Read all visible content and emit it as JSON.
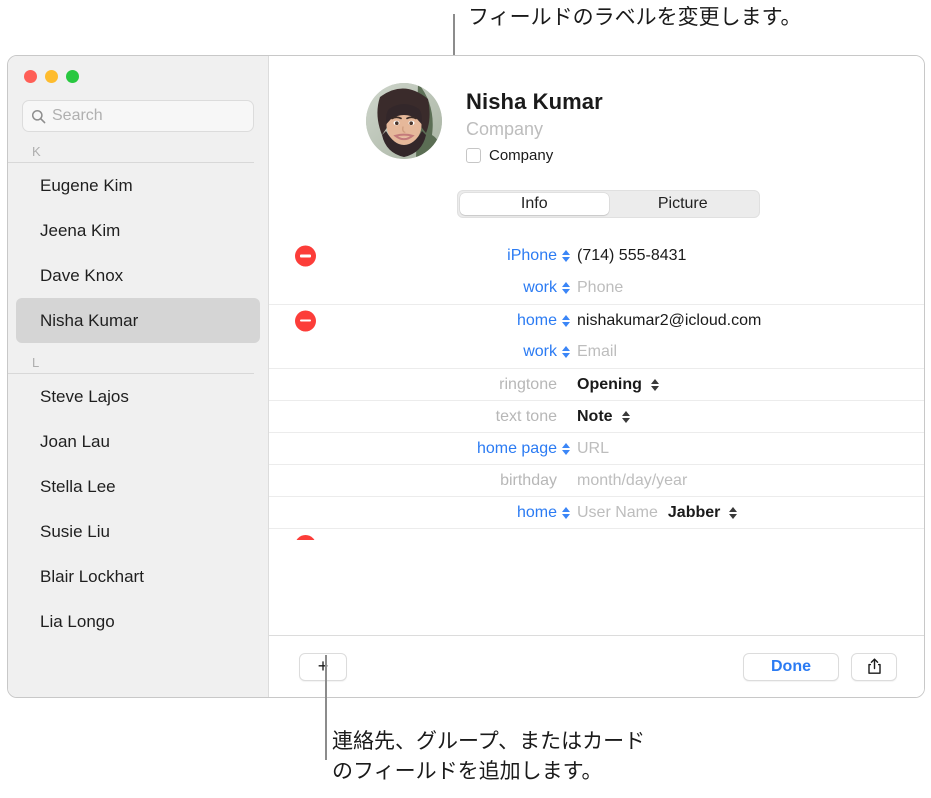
{
  "callouts": {
    "top": "フィールドのラベルを変更します。",
    "bottom": "連絡先、グループ、またはカード\nのフィールドを追加します。"
  },
  "window": {
    "traffic_lights": [
      "close",
      "minimize",
      "maximize"
    ]
  },
  "sidebar": {
    "search": {
      "value": "",
      "placeholder": "Search",
      "icon": "search-icon"
    },
    "sections": [
      {
        "letter": "K",
        "contacts": [
          {
            "name": "Eugene Kim",
            "selected": false
          },
          {
            "name": "Jeena Kim",
            "selected": false
          },
          {
            "name": "Dave Knox",
            "selected": false
          },
          {
            "name": "Nisha Kumar",
            "selected": true
          }
        ]
      },
      {
        "letter": "L",
        "contacts": [
          {
            "name": "Steve Lajos",
            "selected": false
          },
          {
            "name": "Joan Lau",
            "selected": false
          },
          {
            "name": "Stella Lee",
            "selected": false
          },
          {
            "name": "Susie Liu",
            "selected": false
          },
          {
            "name": "Blair Lockhart",
            "selected": false
          },
          {
            "name": "Lia Longo",
            "selected": false
          }
        ]
      }
    ]
  },
  "detail": {
    "avatar_alt": "contact-photo",
    "name": "Nisha  Kumar",
    "company_placeholder": "Company",
    "company_checkbox_label": "Company",
    "company_checked": false,
    "tabs": [
      {
        "label": "Info",
        "active": true
      },
      {
        "label": "Picture",
        "active": false
      }
    ],
    "fields": [
      {
        "remove": true,
        "separator": false,
        "label": "iPhone",
        "label_style": "blue",
        "stepper": "blue",
        "value": "(714) 555-8431",
        "value_style": "filled"
      },
      {
        "remove": false,
        "separator": false,
        "label": "work",
        "label_style": "blue",
        "stepper": "blue",
        "value": "Phone",
        "value_style": "placeholder"
      },
      {
        "remove": true,
        "separator": true,
        "label": "home",
        "label_style": "blue",
        "stepper": "blue",
        "value": "nishakumar2@icloud.com",
        "value_style": "filled"
      },
      {
        "remove": false,
        "separator": false,
        "label": "work",
        "label_style": "blue",
        "stepper": "blue",
        "value": "Email",
        "value_style": "placeholder"
      },
      {
        "remove": false,
        "separator": true,
        "label": "ringtone",
        "label_style": "gray",
        "stepper": "none",
        "value": "Opening",
        "value_style": "bold",
        "value_stepper": "dark"
      },
      {
        "remove": false,
        "separator": true,
        "label": "text tone",
        "label_style": "gray",
        "stepper": "none",
        "value": "Note",
        "value_style": "bold",
        "value_stepper": "dark"
      },
      {
        "remove": false,
        "separator": true,
        "label": "home page",
        "label_style": "blue",
        "stepper": "blue",
        "value": "URL",
        "value_style": "placeholder"
      },
      {
        "remove": false,
        "separator": true,
        "label": "birthday",
        "label_style": "gray",
        "stepper": "none",
        "value": "month/day/year",
        "value_style": "placeholder"
      },
      {
        "remove": false,
        "separator": true,
        "label": "home",
        "label_style": "blue",
        "stepper": "blue",
        "value": "User Name",
        "value_style": "placeholder",
        "value2": "Jabber",
        "value2_style": "bold",
        "value2_stepper": "dark"
      }
    ]
  },
  "bottom_bar": {
    "add_label": "+",
    "done_label": "Done",
    "share_icon": "share-icon"
  },
  "colors": {
    "accent_blue": "#2b7bf3",
    "remove_red": "#fc3d39",
    "placeholder_gray": "#bdbdbd",
    "sidebar_bg": "#f0f0f0",
    "selected_row": "#d5d5d5"
  }
}
